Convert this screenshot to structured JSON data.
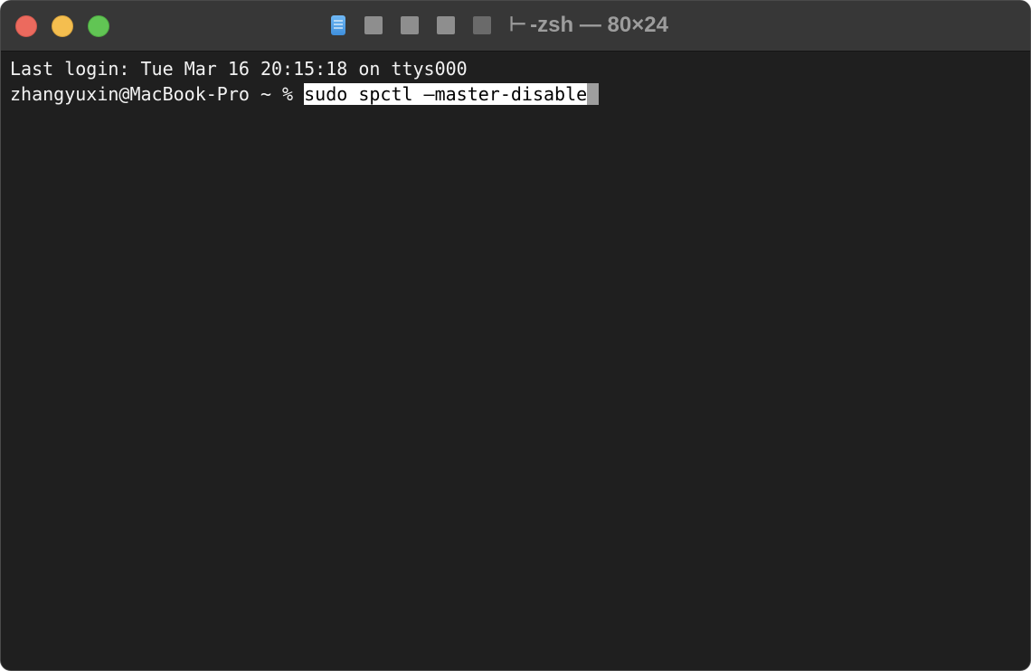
{
  "window": {
    "title": "-zsh — 80×24",
    "path_glyph": "⊢"
  },
  "terminal": {
    "last_login": "Last login: Tue Mar 16 20:15:18 on ttys000",
    "prompt": "zhangyuxin@MacBook-Pro ~ % ",
    "command": "sudo spctl —master-disable"
  },
  "icons": {
    "close": "close-icon",
    "minimize": "minimize-icon",
    "zoom": "zoom-icon",
    "proxy": "document-proxy-icon"
  },
  "colors": {
    "background": "#1f1f1f",
    "titlebar": "#373737",
    "text": "#f2f2f2",
    "close": "#ec6a5e",
    "minimize": "#f4be4f",
    "zoom": "#61c554"
  }
}
